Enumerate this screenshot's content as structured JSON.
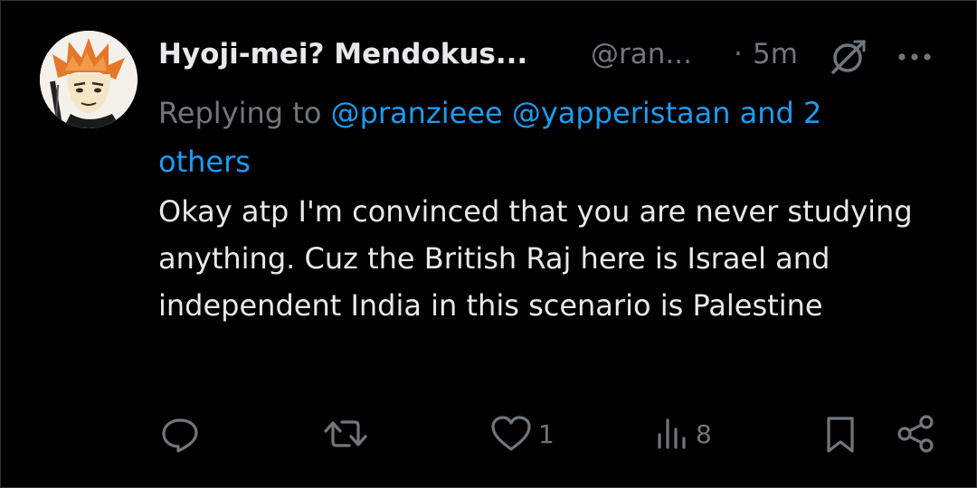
{
  "tweet": {
    "display_name": "Hyoji-mei? Mendokus...",
    "handle": "@ran...",
    "separator": "·",
    "time": "5m",
    "reply_prefix": "Replying to",
    "reply_mentions": "@pranzieee @yapperistaan and 2 others",
    "text": "Okay atp I'm convinced that you are never studying anything. Cuz the British Raj here is Israel and independent India in this scenario is Palestine"
  },
  "actions": {
    "reply_icon": "reply-icon",
    "retweet_icon": "retweet-icon",
    "like_icon": "heart-icon",
    "like_count": "1",
    "views_icon": "views-icon",
    "views_count": "8",
    "bookmark_icon": "bookmark-icon",
    "share_icon": "share-icon"
  },
  "header_icons": {
    "grok": "grok-icon",
    "more": "more-icon"
  },
  "colors": {
    "background": "#000000",
    "text": "#e7e9ea",
    "muted": "#71767b",
    "link": "#1d9bf0"
  }
}
